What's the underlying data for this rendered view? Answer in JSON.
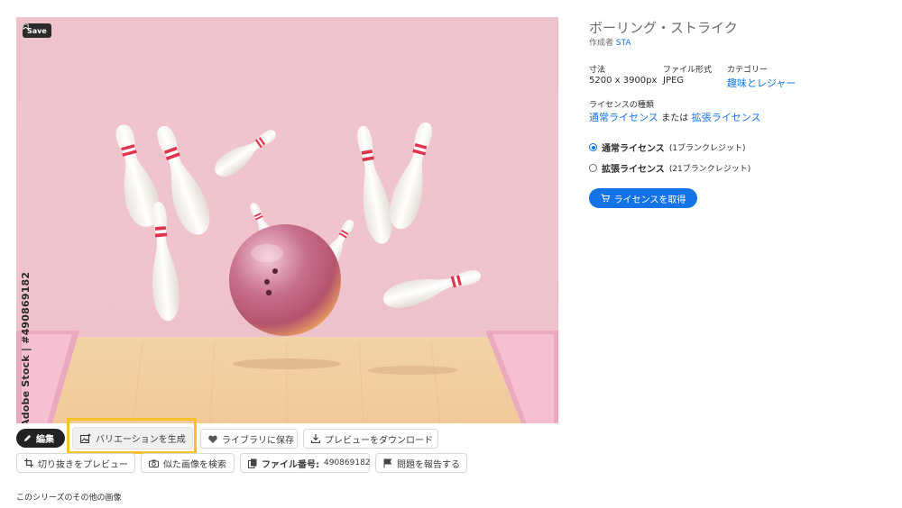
{
  "image": {
    "save_label": "Save",
    "stock_label": "Adobe Stock | #490869182"
  },
  "actions": {
    "edit_label": "編集",
    "variation_label": "バリエーションを生成",
    "library_label": "ライブラリに保存",
    "preview_download_label": "プレビューをダウンロード",
    "crop_preview_label": "切り抜きをプレビュー",
    "similar_label": "似た画像を検索",
    "file_number_label": "ファイル番号:",
    "file_number_value": "490869182",
    "report_label": "問題を報告する"
  },
  "series_label": "このシリーズのその他の画像",
  "details": {
    "title": "ボーリング・ストライク",
    "author_prefix": "作成者",
    "author_name": "STA",
    "size_label": "寸法",
    "size_value": "5200 x 3900px",
    "format_label": "ファイル形式",
    "format_value": "JPEG",
    "category_label": "カテゴリー",
    "category_value": "趣味とレジャー",
    "license_type_label": "ライセンスの種類",
    "license_standard_link": "通常ライセンス",
    "license_or": "または",
    "license_extended_link": "拡張ライセンス",
    "options": [
      {
        "name": "通常ライセンス",
        "credit": "(1ブランクレジット)",
        "selected": true
      },
      {
        "name": "拡張ライセンス",
        "credit": "(21ブランクレジット)",
        "selected": false
      }
    ],
    "get_license_label": "ライセンスを取得"
  },
  "colors": {
    "accent": "#1473e6",
    "highlight": "#f6c22a",
    "photo_bg": "#efc3cb"
  }
}
